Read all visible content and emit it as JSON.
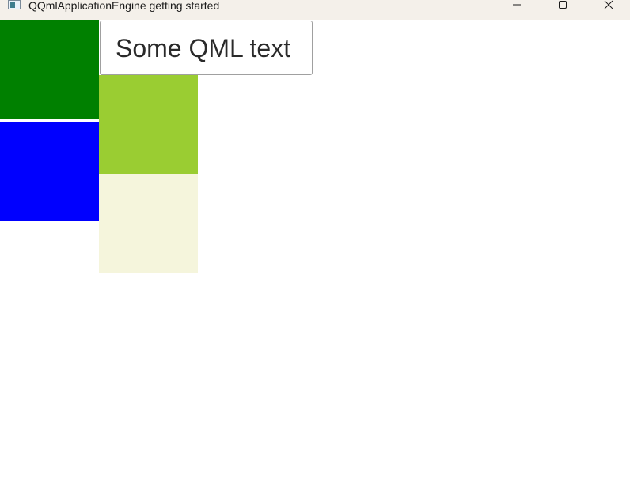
{
  "window": {
    "title": "QQmlApplicationEngine getting started",
    "icon": "app-window-icon",
    "controls": {
      "minimize": "minimize-icon",
      "maximize": "maximize-icon",
      "close": "close-icon"
    }
  },
  "content": {
    "text_box": {
      "text": "Some QML text"
    },
    "rectangles": [
      {
        "name": "green",
        "color": "#008000"
      },
      {
        "name": "blue",
        "color": "#0000ff"
      },
      {
        "name": "yellowgreen",
        "color": "#9acd32"
      },
      {
        "name": "beige",
        "color": "#f5f5dc"
      }
    ]
  }
}
